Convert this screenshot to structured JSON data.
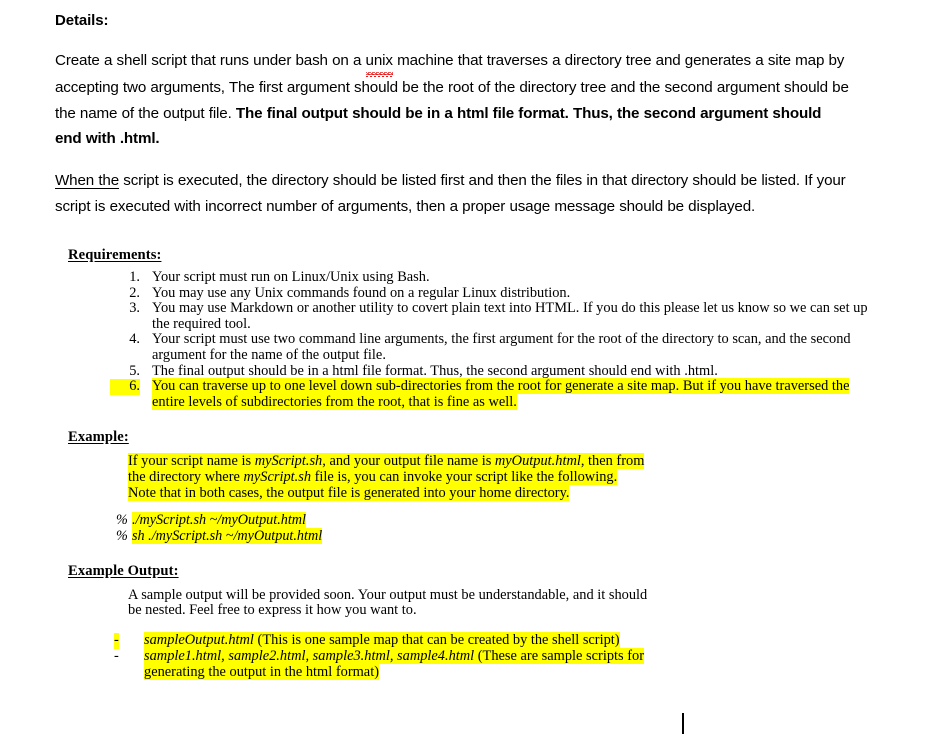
{
  "document": {
    "details_heading": "Details:",
    "paragraph1": {
      "part1": "Create a shell script that runs under bash on a ",
      "misspelled_word": "unix",
      "part2": " machine that traverses a directory tree and generates a site map by accepting two arguments, The first argument should be the root of the directory tree and the second argument should be the  name  of  the  output  file. ",
      "bold_part": "The final output should be in a html file format. Thus, the second argument should end with .html."
    },
    "paragraph2": {
      "underlined_lead": "When the",
      "rest": " script  is  executed,  the directory should be listed first and then the files in that directory should be listed. If your script is executed with incorrect number of arguments, then a proper usage message should be displayed."
    },
    "requirements": {
      "heading": "Requirements:",
      "items": [
        {
          "num": "1.",
          "text": "Your script must run on Linux/Unix using Bash.",
          "highlighted": false
        },
        {
          "num": "2.",
          "text": "You may use any Unix commands found on a regular Linux distribution.",
          "highlighted": false
        },
        {
          "num": "3.",
          "text": "You may use Markdown or another utility to covert plain text into HTML. If you do this please let us know so we can set up the required tool.",
          "highlighted": false
        },
        {
          "num": "4.",
          "text": "Your script must use two command line arguments, the first argument for the root of the directory to scan, and the second argument for the name of the output file.",
          "highlighted": false
        },
        {
          "num": "5.",
          "text": "The final output should be in a html file format. Thus, the second argument should end with .html.",
          "highlighted": false
        },
        {
          "num": "6.",
          "text": "You can traverse up to one level down sub-directories from the root for generate a site map. But if you have traversed the entire levels of subdirectories from the root, that is fine as well.",
          "highlighted": true
        }
      ]
    },
    "example": {
      "heading": "Example:",
      "text_part1": "If your script name is ",
      "script_name": "myScript.sh",
      "text_part2": ", and your output file name is ",
      "output_name": "myOutput.html",
      "text_part3": ", then from the directory where ",
      "script_name2": "myScript.sh",
      "text_part4": " file is, you can invoke your script like the following. Note that in both cases, the output file is generated into your home directory.",
      "commands": [
        {
          "prompt": "%",
          "command": "./myScript.sh ~/myOutput.html"
        },
        {
          "prompt": "%",
          "command": "sh ./myScript.sh ~/myOutput.html"
        }
      ]
    },
    "example_output": {
      "heading": "Example Output:",
      "paragraph": "A sample output will be provided soon. Your output must be understandable, and it should be nested. Feel free to express it how you want to.",
      "items": [
        {
          "dash": "-",
          "dash_highlighted": true,
          "file_names": "sampleOutput.html",
          "description": " (This is one sample map that can be created by the shell script)"
        },
        {
          "dash": "-",
          "dash_highlighted": false,
          "file_names": "sample1.html, sample2.html, sample3.html, sample4.html",
          "description": " (These are sample scripts for generating the output in the html format)"
        }
      ]
    }
  },
  "colors": {
    "highlight": "#ffff00",
    "spellcheck": "#e02020",
    "text": "#000000",
    "background": "#ffffff"
  }
}
